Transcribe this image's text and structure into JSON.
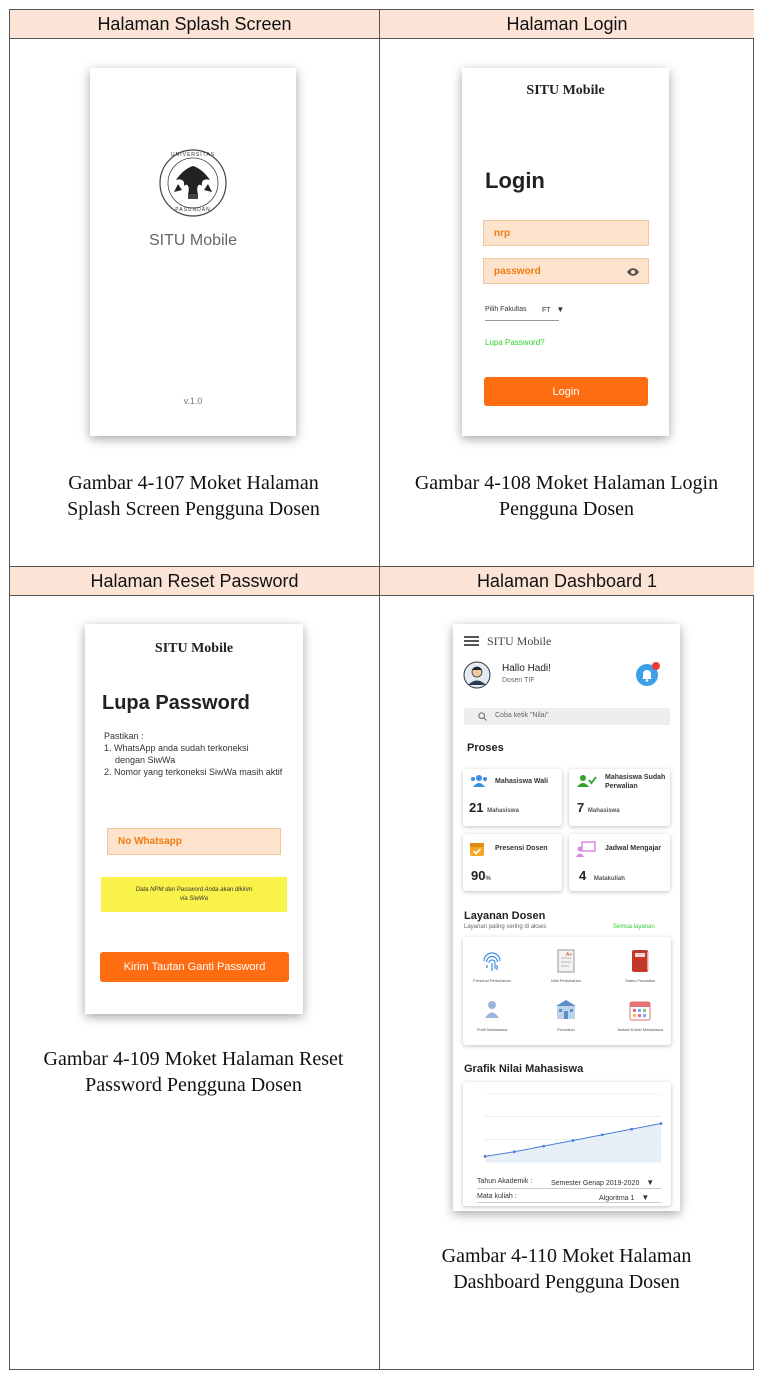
{
  "headers": {
    "splash": "Halaman Splash Screen",
    "login": "Halaman Login",
    "reset": "Halaman Reset Password",
    "dashboard": "Halaman Dashboard 1"
  },
  "captions": {
    "splash_l1": "Gambar 4-107 Moket Halaman",
    "splash_l2": "Splash Screen Pengguna Dosen",
    "login_l1": "Gambar 4-108 Moket Halaman Login",
    "login_l2": "Pengguna Dosen",
    "reset_l1": "Gambar 4-109 Moket Halaman Reset",
    "reset_l2": "Password Pengguna Dosen",
    "dash_l1": "Gambar 4-110 Moket Halaman",
    "dash_l2": "Dashboard Pengguna Dosen"
  },
  "splash": {
    "title": "SITU Mobile",
    "version": "v.1.0",
    "logo_icon": "university-seal-icon",
    "seal_text_top": "UNIVERSITAS",
    "seal_text_bottom": "PASUNDAN"
  },
  "login": {
    "app_title": "SITU Mobile",
    "heading": "Login",
    "nrp_placeholder": "nrp",
    "password_placeholder": "password",
    "fakultas_label": "Pilih Fakultas",
    "fakultas_value": "FT",
    "forgot": "Lupa Password?",
    "button": "Login"
  },
  "reset": {
    "app_title": "SITU Mobile",
    "heading": "Lupa Password",
    "intro": "Pastikan :",
    "item1_l1": "1. WhatsApp anda sudah terkoneksi",
    "item1_l2": "dengan SiwWa",
    "item2": "2. Nomor yang terkoneksi SiwWa masih aktif",
    "wa_placeholder": "No Whatsapp",
    "note_l1": "Data NPM dan Password Anda akan dikirim",
    "note_l2": "via SiwWa",
    "button": "Kirim Tautan Ganti Password"
  },
  "dashboard": {
    "app_title": "SITU Mobile",
    "greeting": "Hallo Hadi!",
    "role": "Dosen TIF",
    "search_placeholder": "Coba ketik \"Nilai\"",
    "proses_title": "Proses",
    "cards": [
      {
        "label": "Mahasiswa Wali",
        "value": "21",
        "unit": "Mahasiswa"
      },
      {
        "label_l1": "Mahasiswa Sudah",
        "label_l2": "Perwalian",
        "value": "7",
        "unit": "Mahasiswa"
      },
      {
        "label": "Presensi Dosen",
        "value": "90",
        "unit": "%"
      },
      {
        "label": "Jadwal Mengajar",
        "value": "4",
        "unit": "Matakuliah"
      }
    ],
    "layanan_title": "Layanan Dosen",
    "layanan_sub": "Layanan paling sering di akses",
    "layanan_all": "Semua layanan",
    "services": [
      "Presensi Perkuliahan",
      "Nilai Perkuliahan",
      "Status Perwalian",
      "Profil Mahasiswa",
      "Perwalian",
      "Jadwal Kuliah Mahasiswa"
    ],
    "grafik_title": "Grafik Nilai Mahasiswa",
    "tahun_label": "Tahun Akademik :",
    "tahun_value": "Semester Genap 2019-2020",
    "matkul_label": "Mata kuliah :",
    "matkul_value": "Algoritma 1"
  },
  "colors": {
    "header_bg": "#fbe4d6",
    "orange": "#ff6d12",
    "field_bg": "#fde3cc",
    "green_link": "#2fd12f",
    "note_yellow": "#f8f24a"
  },
  "chart_data": {
    "type": "line",
    "x": [
      0,
      1,
      2,
      3,
      4,
      5,
      6
    ],
    "values": [
      0.5,
      0.9,
      1.4,
      1.9,
      2.4,
      2.9,
      3.4
    ],
    "title": "",
    "xlabel": "",
    "ylabel": "",
    "ylim": [
      0,
      6
    ],
    "grid": true
  }
}
